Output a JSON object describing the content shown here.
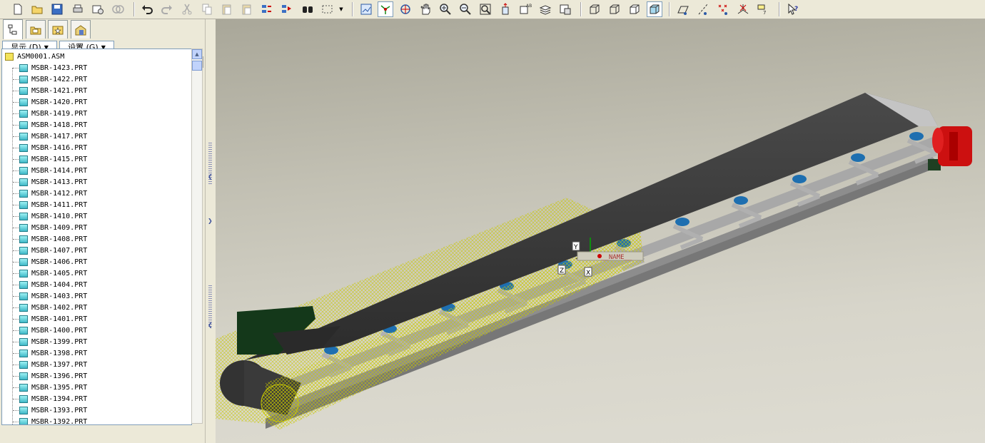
{
  "left_panel": {
    "tabs": [
      {
        "name": "model-tree-tab"
      },
      {
        "name": "folder-browser-tab"
      },
      {
        "name": "favorites-tab"
      },
      {
        "name": "connections-tab"
      }
    ],
    "show_menu": "显示 (D)",
    "settings_menu": "设置 (G)"
  },
  "tree": {
    "root": "ASM0001.ASM",
    "items": [
      "MSBR-1423.PRT",
      "MSBR-1422.PRT",
      "MSBR-1421.PRT",
      "MSBR-1420.PRT",
      "MSBR-1419.PRT",
      "MSBR-1418.PRT",
      "MSBR-1417.PRT",
      "MSBR-1416.PRT",
      "MSBR-1415.PRT",
      "MSBR-1414.PRT",
      "MSBR-1413.PRT",
      "MSBR-1412.PRT",
      "MSBR-1411.PRT",
      "MSBR-1410.PRT",
      "MSBR-1409.PRT",
      "MSBR-1408.PRT",
      "MSBR-1407.PRT",
      "MSBR-1406.PRT",
      "MSBR-1405.PRT",
      "MSBR-1404.PRT",
      "MSBR-1403.PRT",
      "MSBR-1402.PRT",
      "MSBR-1401.PRT",
      "MSBR-1400.PRT",
      "MSBR-1399.PRT",
      "MSBR-1398.PRT",
      "MSBR-1397.PRT",
      "MSBR-1396.PRT",
      "MSBR-1395.PRT",
      "MSBR-1394.PRT",
      "MSBR-1393.PRT",
      "MSBR-1392.PRT"
    ]
  },
  "viewport": {
    "csys_label": "__NAME__",
    "axis_y": "Y",
    "axis_z": "Z",
    "axis_x": "X"
  },
  "colors": {
    "belt": "#3a3a3a",
    "frame": "#9a9a9a",
    "idler": "#1e6fb0",
    "motor": "#cc1010",
    "hopper": "#14381a",
    "guard_mesh": "#c8c800"
  }
}
